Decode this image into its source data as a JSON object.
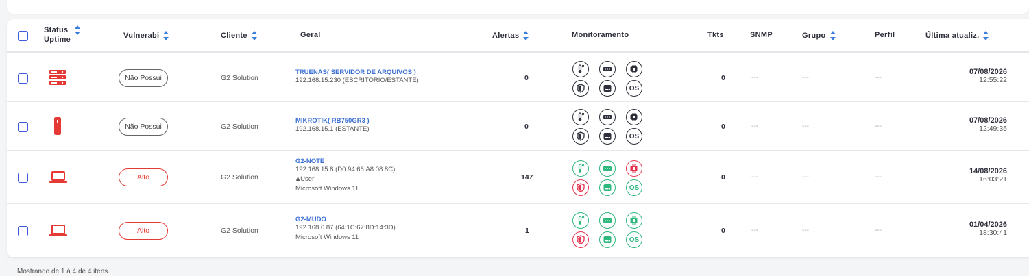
{
  "header": {
    "status": "Status",
    "uptime": "Uptime",
    "vulnerabi": "Vulnerabi",
    "cliente": "Cliente",
    "geral": "Geral",
    "alertas": "Alertas",
    "monitoramento": "Monitoramento",
    "tkts": "Tkts",
    "snmp": "SNMP",
    "grupo": "Grupo",
    "perfil": "Perfil",
    "ultima": "Última atualiz."
  },
  "rows": [
    {
      "device_icon": "server-icon",
      "vulnerability": "Não Possui",
      "client": "G2 Solution",
      "name": "TRUENAS( SERVIDOR DE ARQUIVOS )",
      "line1": "192.168.15.230 (ESCRITORIO/ESTANTE)",
      "line2": "",
      "line3": "",
      "alerts": "0",
      "tkts": "0",
      "snmp": "---",
      "grupo": "---",
      "perfil": "---",
      "date": "07/08/2026",
      "time": "12:55:22",
      "monitor_states": [
        "dark",
        "dark",
        "dark",
        "dark",
        "dark",
        "dark"
      ]
    },
    {
      "device_icon": "router-icon",
      "vulnerability": "Não Possui",
      "client": "G2 Solution",
      "name": "MIKROTIK( RB750GR3 )",
      "line1": "192.168.15.1 (ESTANTE)",
      "line2": "",
      "line3": "",
      "alerts": "0",
      "tkts": "0",
      "snmp": "---",
      "grupo": "---",
      "perfil": "---",
      "date": "07/08/2026",
      "time": "12:49:35",
      "monitor_states": [
        "dark",
        "dark",
        "dark",
        "dark",
        "dark",
        "dark"
      ]
    },
    {
      "device_icon": "laptop-icon",
      "vulnerability": "Alto",
      "client": "G2 Solution",
      "name": "G2-NOTE",
      "line1": "192.168.15.8 (D0:94:66:A8:08:8C)",
      "line2": "User",
      "line3": "Microsoft Windows 11",
      "alerts": "147",
      "tkts": "0",
      "snmp": "---",
      "grupo": "---",
      "perfil": "---",
      "date": "14/08/2026",
      "time": "16:03:21",
      "monitor_states": [
        "green",
        "green",
        "red",
        "red",
        "green",
        "green"
      ]
    },
    {
      "device_icon": "laptop-icon",
      "vulnerability": "Alto",
      "client": "G2 Solution",
      "name": "G2-MUDO",
      "line1": "192.168.0.87 (64:1C:67:8D:14:3D)",
      "line2": "Microsoft Windows 11",
      "line3": "",
      "alerts": "1",
      "tkts": "0",
      "snmp": "---",
      "grupo": "---",
      "perfil": "---",
      "date": "01/04/2026",
      "time": "18:30:41",
      "monitor_states": [
        "green",
        "green",
        "green",
        "red",
        "green",
        "green"
      ]
    }
  ],
  "monitor_icons": [
    "thermometer-icon",
    "memory-icon",
    "cpu-icon",
    "shield-icon",
    "disk-icon",
    "os-icon"
  ],
  "monitor_os_label": "OS",
  "colors": {
    "accent": "#3b7ddd",
    "red": "#e53935",
    "green": "#2db87d",
    "alert_red": "#e5344f"
  },
  "footer": {
    "text": "Mostrando de 1 à 4 de 4 itens."
  }
}
